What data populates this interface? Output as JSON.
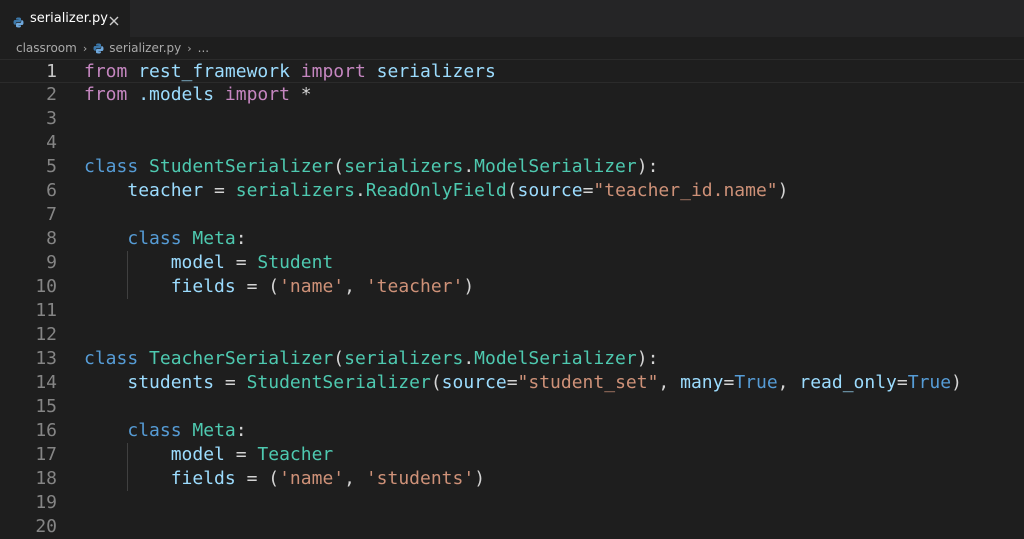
{
  "tab": {
    "filename": "serializer.py",
    "close_icon": "close-icon",
    "file_icon": "python-file-icon"
  },
  "breadcrumb": {
    "folder": "classroom",
    "file": "serializer.py",
    "ellipsis": "..."
  },
  "colors": {
    "keyword_import": "#c586c0",
    "keyword_storage": "#569cd6",
    "class_name": "#4ec9b0",
    "function": "#dcdcaa",
    "variable": "#9cdcfe",
    "string": "#ce9178",
    "text": "#d4d4d4",
    "background": "#1e1e1e"
  },
  "editor": {
    "current_line": 1,
    "lines": [
      {
        "n": "1",
        "tokens": [
          [
            "kw",
            "from"
          ],
          [
            "op",
            " "
          ],
          [
            "var",
            "rest_framework"
          ],
          [
            "op",
            " "
          ],
          [
            "kw",
            "import"
          ],
          [
            "op",
            " "
          ],
          [
            "var",
            "serializers"
          ]
        ]
      },
      {
        "n": "2",
        "tokens": [
          [
            "kw",
            "from"
          ],
          [
            "op",
            " "
          ],
          [
            "var",
            ".models"
          ],
          [
            "op",
            " "
          ],
          [
            "kw",
            "import"
          ],
          [
            "op",
            " *"
          ]
        ]
      },
      {
        "n": "3",
        "tokens": []
      },
      {
        "n": "4",
        "tokens": []
      },
      {
        "n": "5",
        "tokens": [
          [
            "st",
            "class"
          ],
          [
            "op",
            " "
          ],
          [
            "cls",
            "StudentSerializer"
          ],
          [
            "op",
            "("
          ],
          [
            "cls",
            "serializers"
          ],
          [
            "op",
            "."
          ],
          [
            "cls",
            "ModelSerializer"
          ],
          [
            "op",
            "):"
          ]
        ]
      },
      {
        "n": "6",
        "tokens": [
          [
            "op",
            "    "
          ],
          [
            "var",
            "teacher"
          ],
          [
            "op",
            " = "
          ],
          [
            "cls",
            "serializers"
          ],
          [
            "op",
            "."
          ],
          [
            "cls",
            "ReadOnlyField"
          ],
          [
            "op",
            "("
          ],
          [
            "var",
            "source"
          ],
          [
            "op",
            "="
          ],
          [
            "str",
            "\"teacher_id.name\""
          ],
          [
            "op",
            ")"
          ]
        ]
      },
      {
        "n": "7",
        "tokens": []
      },
      {
        "n": "8",
        "tokens": [
          [
            "op",
            "    "
          ],
          [
            "st",
            "class"
          ],
          [
            "op",
            " "
          ],
          [
            "cls",
            "Meta"
          ],
          [
            "op",
            ":"
          ]
        ]
      },
      {
        "n": "9",
        "tokens": [
          [
            "op",
            "        "
          ],
          [
            "var",
            "model"
          ],
          [
            "op",
            " = "
          ],
          [
            "cls",
            "Student"
          ]
        ]
      },
      {
        "n": "10",
        "tokens": [
          [
            "op",
            "        "
          ],
          [
            "var",
            "fields"
          ],
          [
            "op",
            " = ("
          ],
          [
            "str",
            "'name'"
          ],
          [
            "op",
            ", "
          ],
          [
            "str",
            "'teacher'"
          ],
          [
            "op",
            ")"
          ]
        ]
      },
      {
        "n": "11",
        "tokens": []
      },
      {
        "n": "12",
        "tokens": []
      },
      {
        "n": "13",
        "tokens": [
          [
            "st",
            "class"
          ],
          [
            "op",
            " "
          ],
          [
            "cls",
            "TeacherSerializer"
          ],
          [
            "op",
            "("
          ],
          [
            "cls",
            "serializers"
          ],
          [
            "op",
            "."
          ],
          [
            "cls",
            "ModelSerializer"
          ],
          [
            "op",
            "):"
          ]
        ]
      },
      {
        "n": "14",
        "tokens": [
          [
            "op",
            "    "
          ],
          [
            "var",
            "students"
          ],
          [
            "op",
            " = "
          ],
          [
            "cls",
            "StudentSerializer"
          ],
          [
            "op",
            "("
          ],
          [
            "var",
            "source"
          ],
          [
            "op",
            "="
          ],
          [
            "str",
            "\"student_set\""
          ],
          [
            "op",
            ", "
          ],
          [
            "var",
            "many"
          ],
          [
            "op",
            "="
          ],
          [
            "st",
            "True"
          ],
          [
            "op",
            ", "
          ],
          [
            "var",
            "read_only"
          ],
          [
            "op",
            "="
          ],
          [
            "st",
            "True"
          ],
          [
            "op",
            ")"
          ]
        ]
      },
      {
        "n": "15",
        "tokens": []
      },
      {
        "n": "16",
        "tokens": [
          [
            "op",
            "    "
          ],
          [
            "st",
            "class"
          ],
          [
            "op",
            " "
          ],
          [
            "cls",
            "Meta"
          ],
          [
            "op",
            ":"
          ]
        ]
      },
      {
        "n": "17",
        "tokens": [
          [
            "op",
            "        "
          ],
          [
            "var",
            "model"
          ],
          [
            "op",
            " = "
          ],
          [
            "cls",
            "Teacher"
          ]
        ]
      },
      {
        "n": "18",
        "tokens": [
          [
            "op",
            "        "
          ],
          [
            "var",
            "fields"
          ],
          [
            "op",
            " = ("
          ],
          [
            "str",
            "'name'"
          ],
          [
            "op",
            ", "
          ],
          [
            "str",
            "'students'"
          ],
          [
            "op",
            ")"
          ]
        ]
      },
      {
        "n": "19",
        "tokens": []
      },
      {
        "n": "20",
        "tokens": []
      }
    ]
  }
}
